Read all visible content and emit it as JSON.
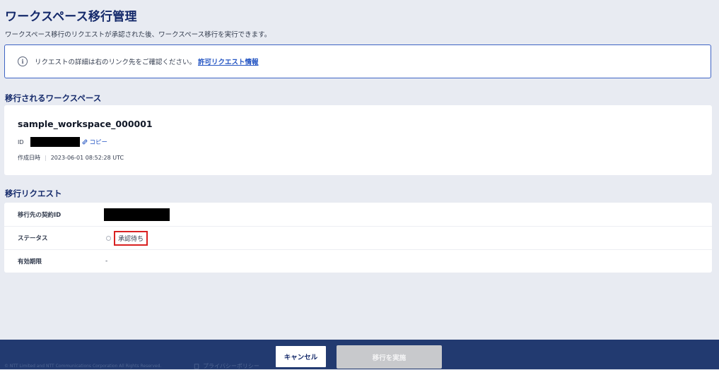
{
  "page": {
    "title": "ワークスペース移行管理",
    "description": "ワークスペース移行のリクエストが承認された後、ワークスペース移行を実行できます。"
  },
  "info": {
    "icon": "info-icon",
    "text": "リクエストの詳細は右のリンク先をご確認ください。",
    "link_text": "許可リクエスト情報"
  },
  "workspace_section": {
    "title": "移行されるワークスペース",
    "name": "sample_workspace_000001",
    "id_label": "ID",
    "copy_label": "コピー",
    "created_label": "作成日時",
    "created_value": "2023-06-01 08:52:28 UTC"
  },
  "request_section": {
    "title": "移行リクエスト",
    "rows": [
      {
        "label": "移行先の契約ID",
        "value": ""
      },
      {
        "label": "ステータス",
        "value": "承認待ち"
      },
      {
        "label": "有効期限",
        "value": "-"
      }
    ]
  },
  "footer": {
    "copyright": "© NTT Limited and NTT Communications Corporation All Rights Reserved.",
    "privacy": "プライバシーポリシー",
    "cancel_label": "キャンセル",
    "execute_label": "移行を実施"
  },
  "colors": {
    "title": "#152a6b",
    "link": "#2455c3",
    "footer": "#223a70",
    "highlight": "#d92121"
  }
}
